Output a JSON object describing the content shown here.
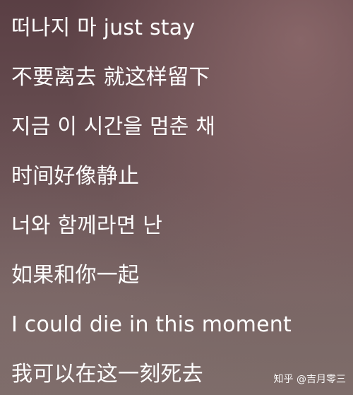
{
  "lyrics": {
    "lines": [
      "떠나지 마 just stay",
      "不要离去 就这样留下",
      "지금 이 시간을 멈춘 채",
      "时间好像静止",
      "너와 함께라면 난",
      "如果和你一起",
      "I could die in this moment",
      "我可以在这一刻死去"
    ]
  },
  "watermark": {
    "text": "知乎 @吉月零三"
  }
}
